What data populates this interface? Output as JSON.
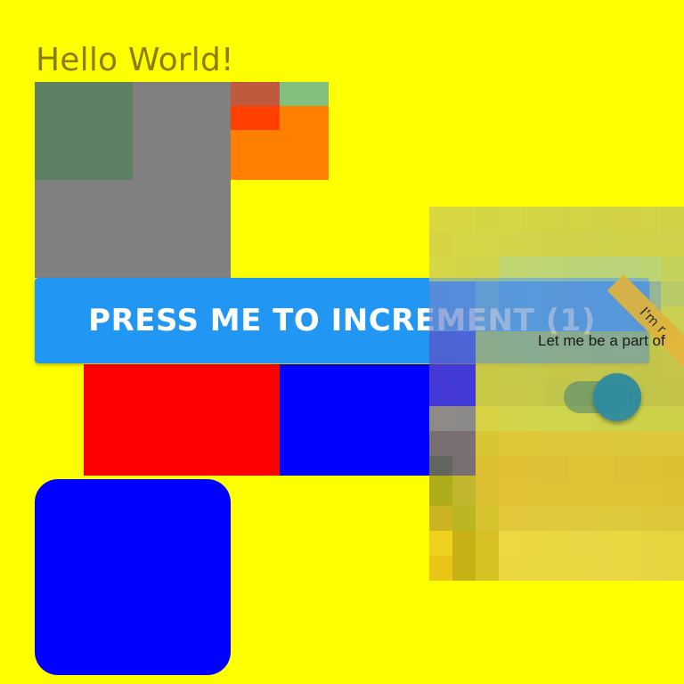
{
  "greeting": "Hello World!",
  "increment_button": {
    "label": "PRESS ME TO INCREMENT (1)"
  },
  "overlay": {
    "banner_text": "I'm r",
    "caption": "Let me be a part of"
  },
  "colors": {
    "background": "#ffff00",
    "button": "#2196f3",
    "red": "#ff0000",
    "blue": "#0000ff",
    "gray": "#808080",
    "orange": "#ff7f00"
  },
  "icons": {
    "toggle": "switch-toggle"
  }
}
